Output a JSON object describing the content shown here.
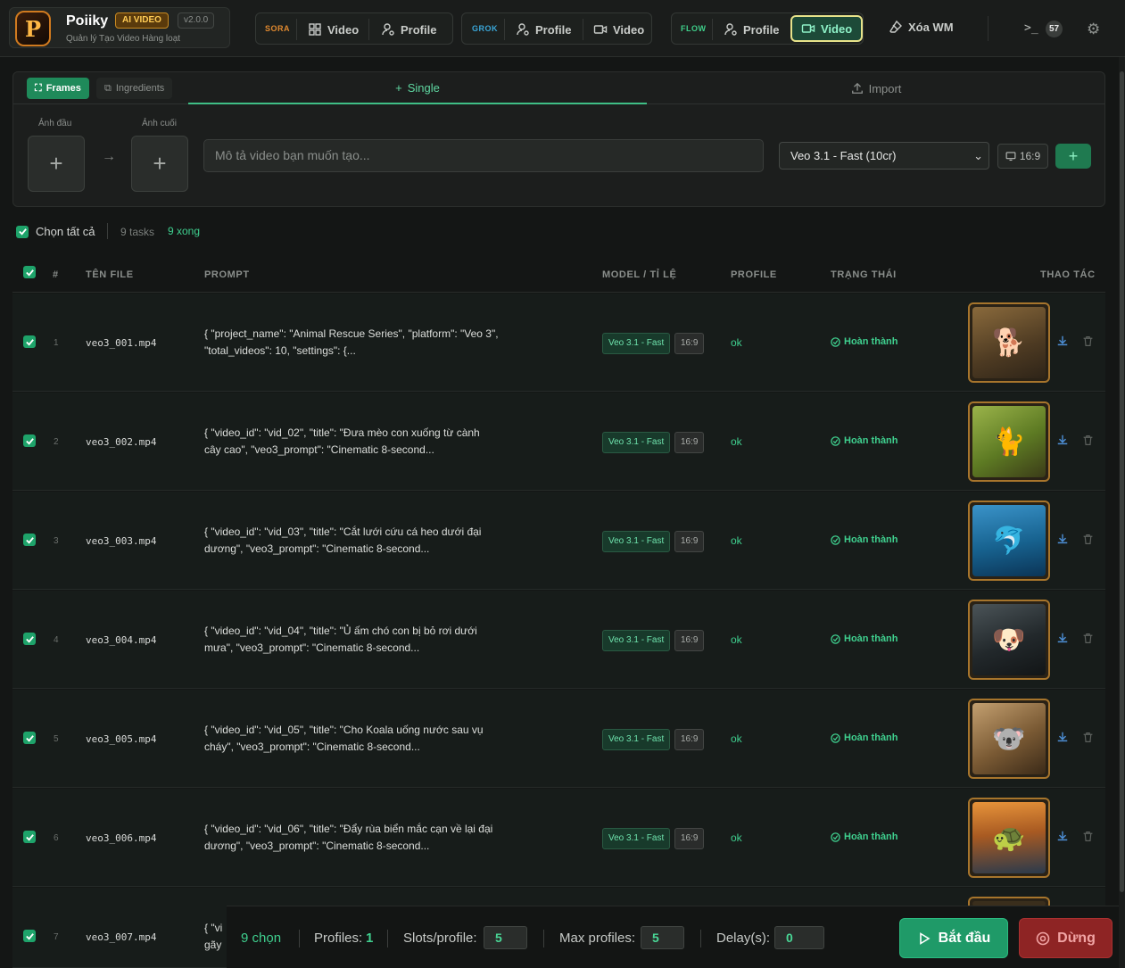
{
  "brand": {
    "name": "Poiiky",
    "badge": "AI VIDEO",
    "version": "v2.0.0",
    "subtitle": "Quản lý Tạo Video Hàng loạt",
    "logo_letter": "P"
  },
  "nav": {
    "sora": {
      "label": "SORA",
      "video": "Video",
      "profile": "Profile"
    },
    "grok": {
      "label": "GROK",
      "profile": "Profile",
      "video": "Video"
    },
    "flow": {
      "label": "FLOW",
      "profile": "Profile",
      "video": "Video"
    },
    "remove_wm": "Xóa WM",
    "terminal_icon": ">_",
    "count": "57"
  },
  "create": {
    "mode_frames": "Frames",
    "mode_ingredients": "Ingredients",
    "tab_single": "Single",
    "tab_import": "Import",
    "first_frame_label": "Ảnh đầu",
    "last_frame_label": "Ảnh cuối",
    "prompt_placeholder": "Mô tả video bạn muốn tạo...",
    "model": "Veo 3.1 - Fast (10cr)",
    "ratio": "16:9"
  },
  "selection": {
    "select_all": "Chọn tất cả",
    "tasks": "9 tasks",
    "done": "9 xong"
  },
  "table": {
    "headers": {
      "num": "#",
      "file": "TÊN FILE",
      "prompt": "PROMPT",
      "model": "MODEL / TỈ LỆ",
      "profile": "PROFILE",
      "status": "TRẠNG THÁI",
      "actions": "THAO TÁC"
    },
    "rows": [
      {
        "num": "1",
        "file": "veo3_001.mp4",
        "prompt": "{ \"project_name\": \"Animal Rescue Series\", \"platform\": \"Veo 3\", \"total_videos\": 10, \"settings\": {...",
        "model": "Veo 3.1 - Fast",
        "ratio": "16:9",
        "profile": "ok",
        "status": "Hoàn thành",
        "thumb": "🐕"
      },
      {
        "num": "2",
        "file": "veo3_002.mp4",
        "prompt": "{ \"video_id\": \"vid_02\", \"title\": \"Đưa mèo con xuống từ cành cây cao\", \"veo3_prompt\": \"Cinematic 8-second...",
        "model": "Veo 3.1 - Fast",
        "ratio": "16:9",
        "profile": "ok",
        "status": "Hoàn thành",
        "thumb": "🐈"
      },
      {
        "num": "3",
        "file": "veo3_003.mp4",
        "prompt": "{ \"video_id\": \"vid_03\", \"title\": \"Cắt lưới cứu cá heo dưới đại dương\", \"veo3_prompt\": \"Cinematic 8-second...",
        "model": "Veo 3.1 - Fast",
        "ratio": "16:9",
        "profile": "ok",
        "status": "Hoàn thành",
        "thumb": "🐬"
      },
      {
        "num": "4",
        "file": "veo3_004.mp4",
        "prompt": "{ \"video_id\": \"vid_04\", \"title\": \"Ủ ấm chó con bị bỏ rơi dưới mưa\", \"veo3_prompt\": \"Cinematic 8-second...",
        "model": "Veo 3.1 - Fast",
        "ratio": "16:9",
        "profile": "ok",
        "status": "Hoàn thành",
        "thumb": "🐶"
      },
      {
        "num": "5",
        "file": "veo3_005.mp4",
        "prompt": "{ \"video_id\": \"vid_05\", \"title\": \"Cho Koala uống nước sau vụ cháy\", \"veo3_prompt\": \"Cinematic 8-second...",
        "model": "Veo 3.1 - Fast",
        "ratio": "16:9",
        "profile": "ok",
        "status": "Hoàn thành",
        "thumb": "🐨"
      },
      {
        "num": "6",
        "file": "veo3_006.mp4",
        "prompt": "{ \"video_id\": \"vid_06\", \"title\": \"Đẩy rùa biển mắc cạn về lại đại dương\", \"veo3_prompt\": \"Cinematic 8-second...",
        "model": "Veo 3.1 - Fast",
        "ratio": "16:9",
        "profile": "ok",
        "status": "Hoàn thành",
        "thumb": "🐢"
      },
      {
        "num": "7",
        "file": "veo3_007.mp4",
        "prompt": "{ \"vi gãy",
        "model": "",
        "ratio": "",
        "profile": "",
        "status": "",
        "thumb": ""
      }
    ]
  },
  "bottom": {
    "selected": "9 chọn",
    "profiles_label": "Profiles:",
    "profiles_value": "1",
    "slots_label": "Slots/profile:",
    "slots_value": "5",
    "max_label": "Max profiles:",
    "max_value": "5",
    "delay_label": "Delay(s):",
    "delay_value": "0",
    "start": "Bắt đầu",
    "stop": "Dừng"
  },
  "colors": {
    "accent": "#1f9a68",
    "status_ok": "#3fd08f",
    "stop": "#8e2424",
    "brand_orange": "#d07a1f",
    "flow_highlight": "#e7e28a"
  }
}
